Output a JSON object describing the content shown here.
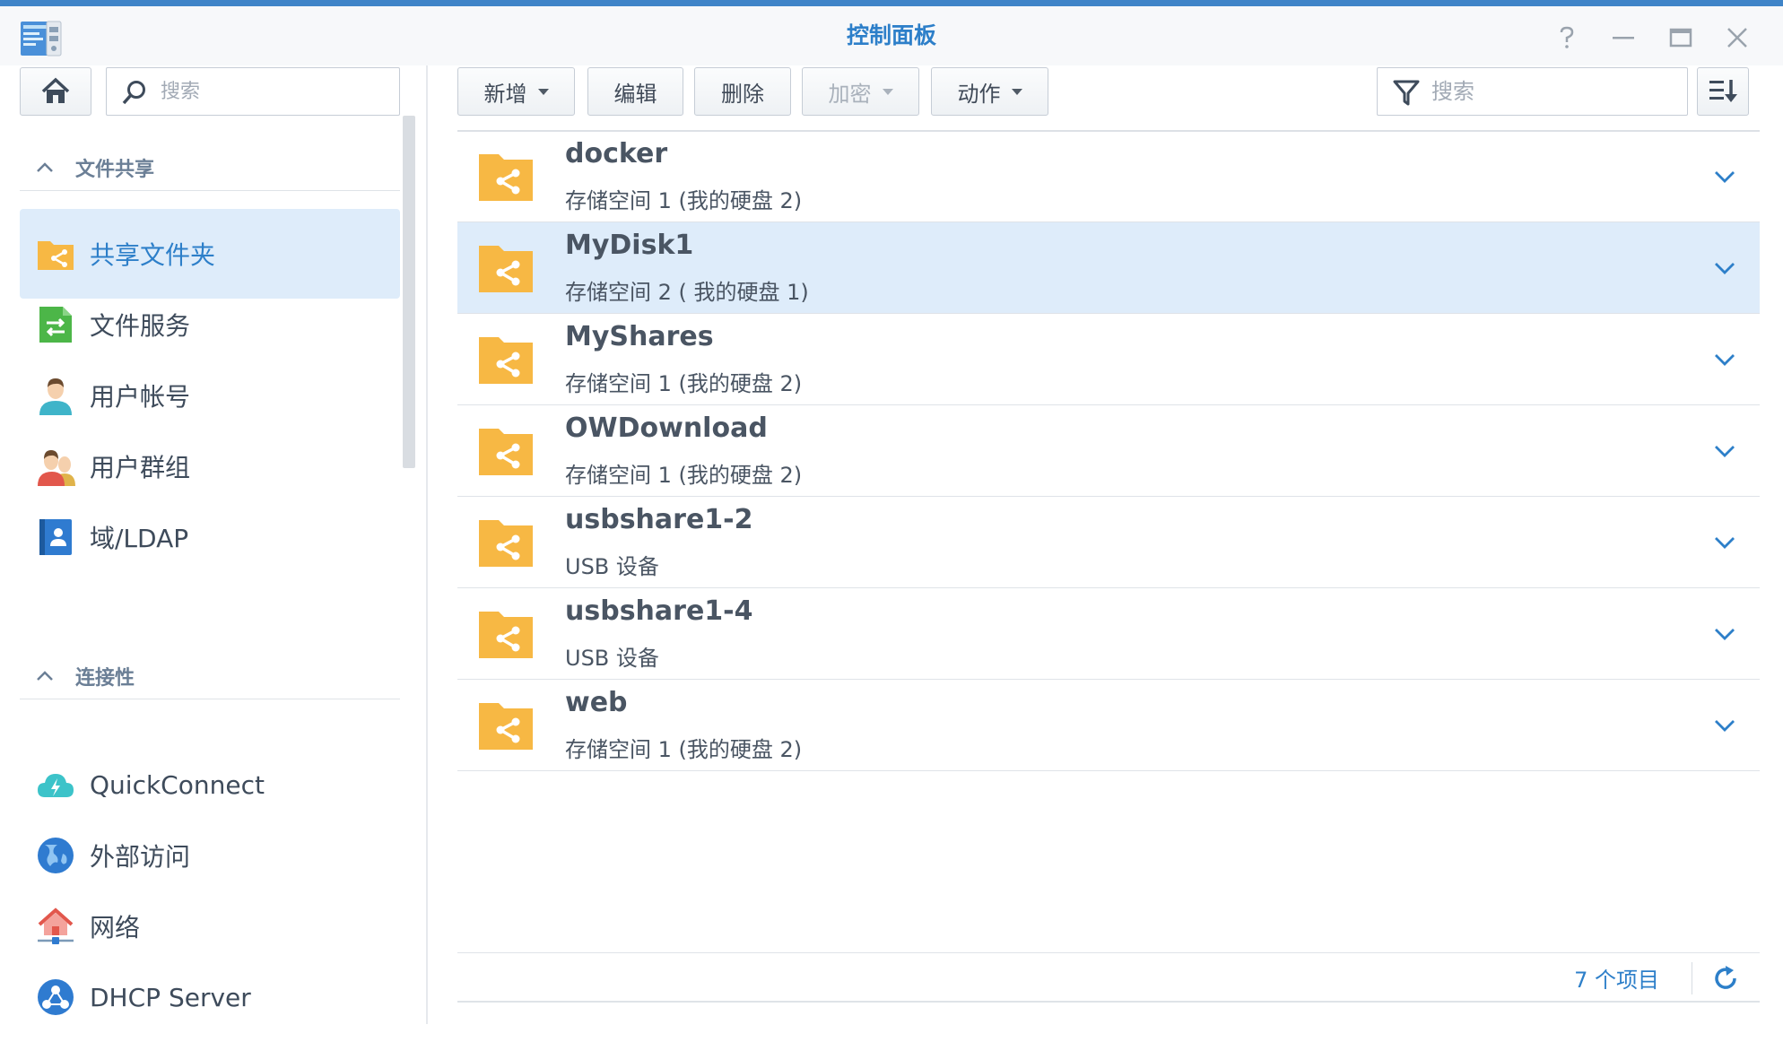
{
  "window": {
    "title": "控制面板",
    "accent_color": "#3f84c8"
  },
  "sidebar": {
    "search_placeholder": "搜索",
    "groups": [
      {
        "label": "文件共享"
      },
      {
        "label": "连接性"
      }
    ],
    "items": [
      {
        "label": "共享文件夹",
        "icon": "shared-folder-icon",
        "active": true
      },
      {
        "label": "文件服务",
        "icon": "file-services-icon"
      },
      {
        "label": "用户帐号",
        "icon": "user-icon"
      },
      {
        "label": "用户群组",
        "icon": "user-group-icon"
      },
      {
        "label": "域/LDAP",
        "icon": "ldap-icon"
      },
      {
        "label": "QuickConnect",
        "icon": "quickconnect-cloud-icon"
      },
      {
        "label": "外部访问",
        "icon": "globe-icon"
      },
      {
        "label": "网络",
        "icon": "network-house-icon"
      },
      {
        "label": "DHCP Server",
        "icon": "dhcp-server-icon"
      }
    ]
  },
  "toolbar": {
    "create": "新增",
    "edit": "编辑",
    "delete": "删除",
    "encrypt": "加密",
    "action": "动作",
    "search_placeholder": "搜索"
  },
  "shares": [
    {
      "name": "docker",
      "location": "存储空间 1 (我的硬盘 2)"
    },
    {
      "name": "MyDisk1",
      "location": "存储空间 2 ( 我的硬盘 1)",
      "selected": true
    },
    {
      "name": "MyShares",
      "location": "存储空间 1 (我的硬盘 2)"
    },
    {
      "name": "OWDownload",
      "location": "存储空间 1 (我的硬盘 2)"
    },
    {
      "name": "usbshare1-2",
      "location": "USB 设备"
    },
    {
      "name": "usbshare1-4",
      "location": "USB 设备"
    },
    {
      "name": "web",
      "location": "存储空间 1 (我的硬盘 2)"
    }
  ],
  "footer": {
    "item_count": "7 个项目"
  },
  "colors": {
    "accent": "#2d7fc9",
    "folder": "#f7b844",
    "selection": "#deecfa"
  }
}
